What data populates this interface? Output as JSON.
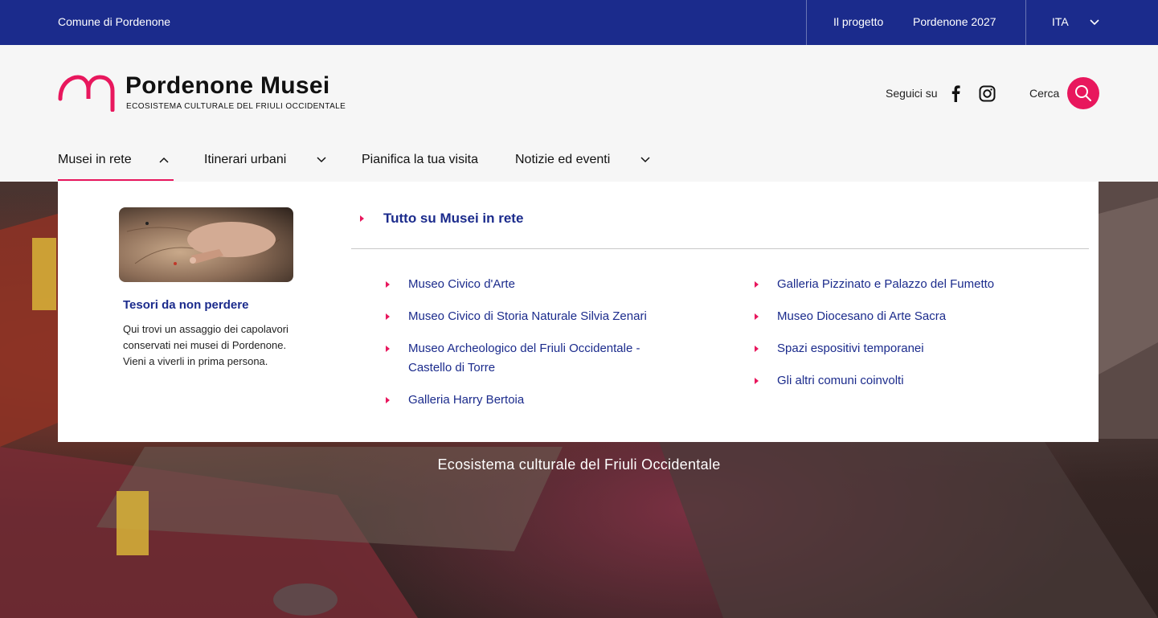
{
  "topbar": {
    "comune": "Comune di Pordenone",
    "links": [
      "Il progetto",
      "Pordenone 2027"
    ],
    "language": "ITA"
  },
  "header": {
    "logo_title": "Pordenone Musei",
    "logo_subtitle": "ECOSISTEMA CULTURALE DEL FRIULI OCCIDENTALE",
    "follow_label": "Seguici su",
    "search_label": "Cerca",
    "accent_color": "#e8175d",
    "brand_color": "#1b2b8c",
    "icons": [
      "facebook-icon",
      "instagram-icon",
      "search-icon"
    ]
  },
  "nav": {
    "items": [
      {
        "label": "Musei in rete",
        "expanded": true
      },
      {
        "label": "Itinerari urbani"
      },
      {
        "label": "Pianifica la tua visita"
      },
      {
        "label": "Notizie ed eventi"
      }
    ]
  },
  "mega_menu": {
    "promo_title": "Tesori da non perdere",
    "promo_text": "Qui trovi un assaggio dei capolavori conservati nei musei di Pordenone. Vieni a viverli in prima persona.",
    "all_link": "Tutto su Musei in rete",
    "left_links": [
      "Museo Civico d'Arte",
      "Museo Civico di Storia Naturale Silvia Zenari",
      "Museo Archeologico del Friuli Occidentale - Castello di Torre",
      "Galleria Harry Bertoia"
    ],
    "right_links": [
      "Galleria Pizzinato e Palazzo del Fumetto",
      "Museo Diocesano di Arte Sacra",
      "Spazi espositivi temporanei",
      "Gli altri comuni coinvolti"
    ]
  },
  "hero": {
    "tagline": "Ecosistema culturale del Friuli Occidentale"
  }
}
